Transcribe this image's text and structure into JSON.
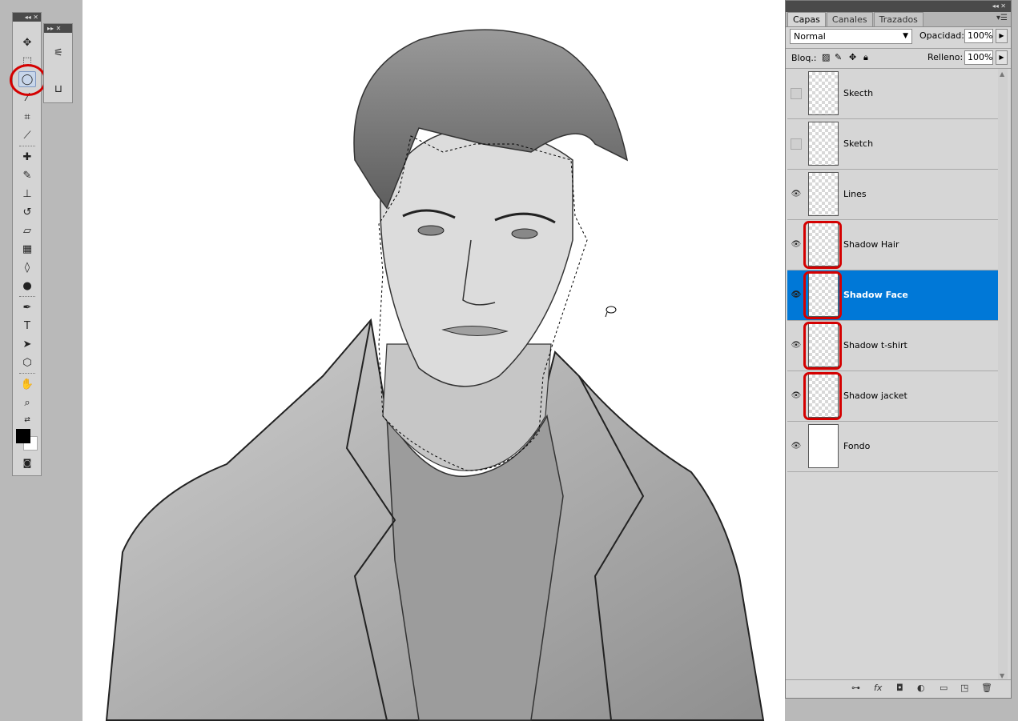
{
  "layers_panel": {
    "tabs": [
      "Capas",
      "Canales",
      "Trazados"
    ],
    "blend_mode": "Normal",
    "opacity_label": "Opacidad:",
    "opacity_value": "100%",
    "lock_label": "Bloq.:",
    "fill_label": "Relleno:",
    "fill_value": "100%",
    "layers": [
      {
        "name": "Skecth",
        "visible": false,
        "selected": false
      },
      {
        "name": "Sketch",
        "visible": false,
        "selected": false
      },
      {
        "name": "Lines",
        "visible": true,
        "selected": false
      },
      {
        "name": "Shadow Hair",
        "visible": true,
        "selected": false
      },
      {
        "name": "Shadow Face",
        "visible": true,
        "selected": true
      },
      {
        "name": "Shadow t-shirt",
        "visible": true,
        "selected": false
      },
      {
        "name": "Shadow jacket",
        "visible": true,
        "selected": false
      },
      {
        "name": "Fondo",
        "visible": true,
        "selected": false
      }
    ]
  },
  "toolbox": {
    "selected_tool": "lasso-tool",
    "tools": [
      "move-tool",
      "marquee-tool",
      "lasso-tool",
      "magic-wand-tool",
      "crop-tool",
      "eyedropper-tool",
      "healing-brush-tool",
      "brush-tool",
      "clone-stamp-tool",
      "history-brush-tool",
      "eraser-tool",
      "gradient-tool",
      "blur-tool",
      "dodge-tool",
      "pen-tool",
      "type-tool",
      "path-selection-tool",
      "shape-tool",
      "hand-tool",
      "zoom-tool"
    ],
    "foreground_color": "#000000",
    "background_color": "#ffffff"
  },
  "colors": {
    "selection_highlight": "#0078d7",
    "annotation_red": "#d40000"
  }
}
